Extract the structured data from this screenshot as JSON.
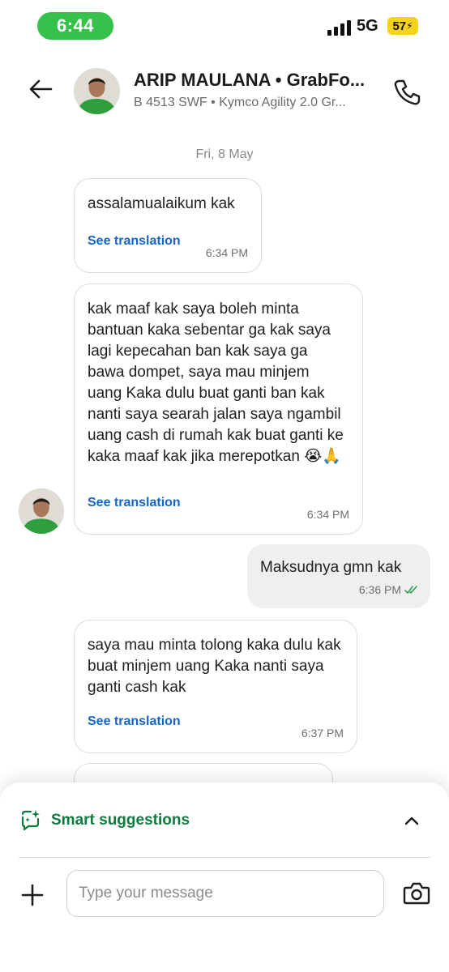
{
  "status_bar": {
    "time": "6:44",
    "network": "5G",
    "battery": "57"
  },
  "header": {
    "name": "ARIP MAULANA • GrabFo...",
    "subtitle": "B 4513 SWF • Kymco Agility 2.0 Gr..."
  },
  "chat": {
    "date": "Fri, 8 May",
    "messages": [
      {
        "text": "assalamualaikum kak",
        "translate": "See translation",
        "time": "6:34 PM"
      },
      {
        "text": "kak maaf kak saya boleh minta bantuan kaka sebentar ga kak saya lagi kepecahan ban kak saya ga bawa dompet, saya mau minjem uang Kaka dulu buat ganti ban kak nanti saya searah jalan saya ngambil uang cash di rumah kak buat ganti ke kaka maaf kak jika merepotkan 😭🙏",
        "translate": "See translation",
        "time": "6:34 PM"
      },
      {
        "text": "Maksudnya gmn kak",
        "time": "6:36 PM"
      },
      {
        "text": "saya mau minta tolong kaka dulu kak buat minjem uang Kaka nanti saya ganti cash kak",
        "translate": "See translation",
        "time": "6:37 PM"
      }
    ]
  },
  "composer": {
    "suggestions_label": "Smart suggestions",
    "placeholder": "Type your message"
  },
  "colors": {
    "brand_green": "#0f7a3e",
    "link_blue": "#1465c9",
    "status_green": "#35c24b",
    "battery_yellow": "#f5d21c"
  }
}
